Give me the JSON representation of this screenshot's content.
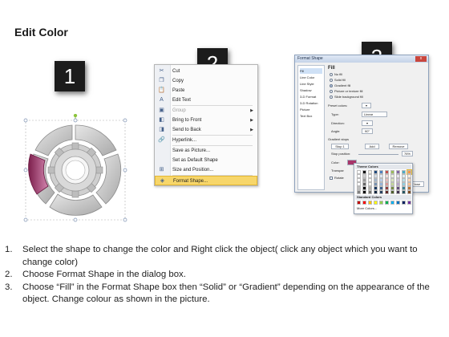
{
  "page": {
    "title": "Edit Color"
  },
  "steps": [
    {
      "number": "1"
    },
    {
      "number": "2"
    },
    {
      "number": "3"
    }
  ],
  "context_menu": {
    "items": [
      {
        "label": "Cut",
        "icon": "scissors-icon",
        "glyph": "✂"
      },
      {
        "label": "Copy",
        "icon": "copy-icon",
        "glyph": "❐"
      },
      {
        "label": "Paste",
        "icon": "paste-icon",
        "glyph": "📋"
      },
      {
        "label": "Edit Text",
        "icon": "edit-text-icon",
        "glyph": "A"
      },
      {
        "label": "Group",
        "icon": "group-icon",
        "glyph": "▣",
        "disabled": true,
        "submenu": true
      },
      {
        "label": "Bring to Front",
        "icon": "bring-front-icon",
        "glyph": "◧",
        "submenu": true
      },
      {
        "label": "Send to Back",
        "icon": "send-back-icon",
        "glyph": "◨",
        "submenu": true
      },
      {
        "label": "Hyperlink...",
        "icon": "hyperlink-icon",
        "glyph": "🔗"
      },
      {
        "label": "Save as Picture...",
        "icon": "",
        "glyph": ""
      },
      {
        "label": "Set as Default Shape",
        "icon": "",
        "glyph": ""
      },
      {
        "label": "Size and Position...",
        "icon": "size-icon",
        "glyph": "⊞"
      },
      {
        "label": "Format Shape...",
        "icon": "format-shape-icon",
        "glyph": "◈",
        "highlight": true
      }
    ]
  },
  "format_dialog": {
    "title": "Format Shape",
    "close_label": "x",
    "nav": [
      "Fill",
      "Line Color",
      "Line Style",
      "Shadow",
      "3-D Format",
      "3-D Rotation",
      "Picture",
      "Text Box"
    ],
    "fill_heading": "Fill",
    "fill_options": [
      "No fill",
      "Solid fill",
      "Gradient fill",
      "Picture or texture fill",
      "Slide background fill"
    ],
    "preset_colors_label": "Preset colors:",
    "type_label": "Type:",
    "type_value": "Linear",
    "direction_label": "Direction:",
    "angle_label": "Angle:",
    "angle_value": "90°",
    "gradient_stops_label": "Gradient stops",
    "stop_value": "Stop 1",
    "add_label": "Add",
    "remove_label": "Remove",
    "stop_position_label": "Stop position:",
    "stop_position_value": "76%",
    "color_label": "Color:",
    "transparency_label": "Transpar",
    "rotate_label": "Rotate",
    "close_button": "Close",
    "theme_colors_label": "Theme Colors",
    "standard_colors_label": "Standard Colors",
    "more_colors_label": "More Colors...",
    "theme_colors": [
      "#ffffff",
      "#000000",
      "#eeece1",
      "#1f497d",
      "#4f81bd",
      "#c0504d",
      "#9bbb59",
      "#8064a2",
      "#4bacc6",
      "#f79646"
    ],
    "standard_colors": [
      "#c00000",
      "#ff0000",
      "#ffc000",
      "#ffff00",
      "#92d050",
      "#00b050",
      "#00b0f0",
      "#0070c0",
      "#002060",
      "#7030a0"
    ]
  },
  "colors": {
    "accent_magenta": "#a8356a",
    "ring_gray": "#b9b9b9",
    "highlight": "#f7d66a"
  },
  "instructions": [
    {
      "num": "1.",
      "text": "Select the shape to change the color and Right click the object( click any object which you want to change color)"
    },
    {
      "num": "2.",
      "text": "Choose Format Shape in the dialog box."
    },
    {
      "num": "3.",
      "text": "Choose “Fill” in the Format Shape box then “Solid” or “Gradient” depending on the appearance of the object. Change colour as shown in the picture."
    }
  ]
}
